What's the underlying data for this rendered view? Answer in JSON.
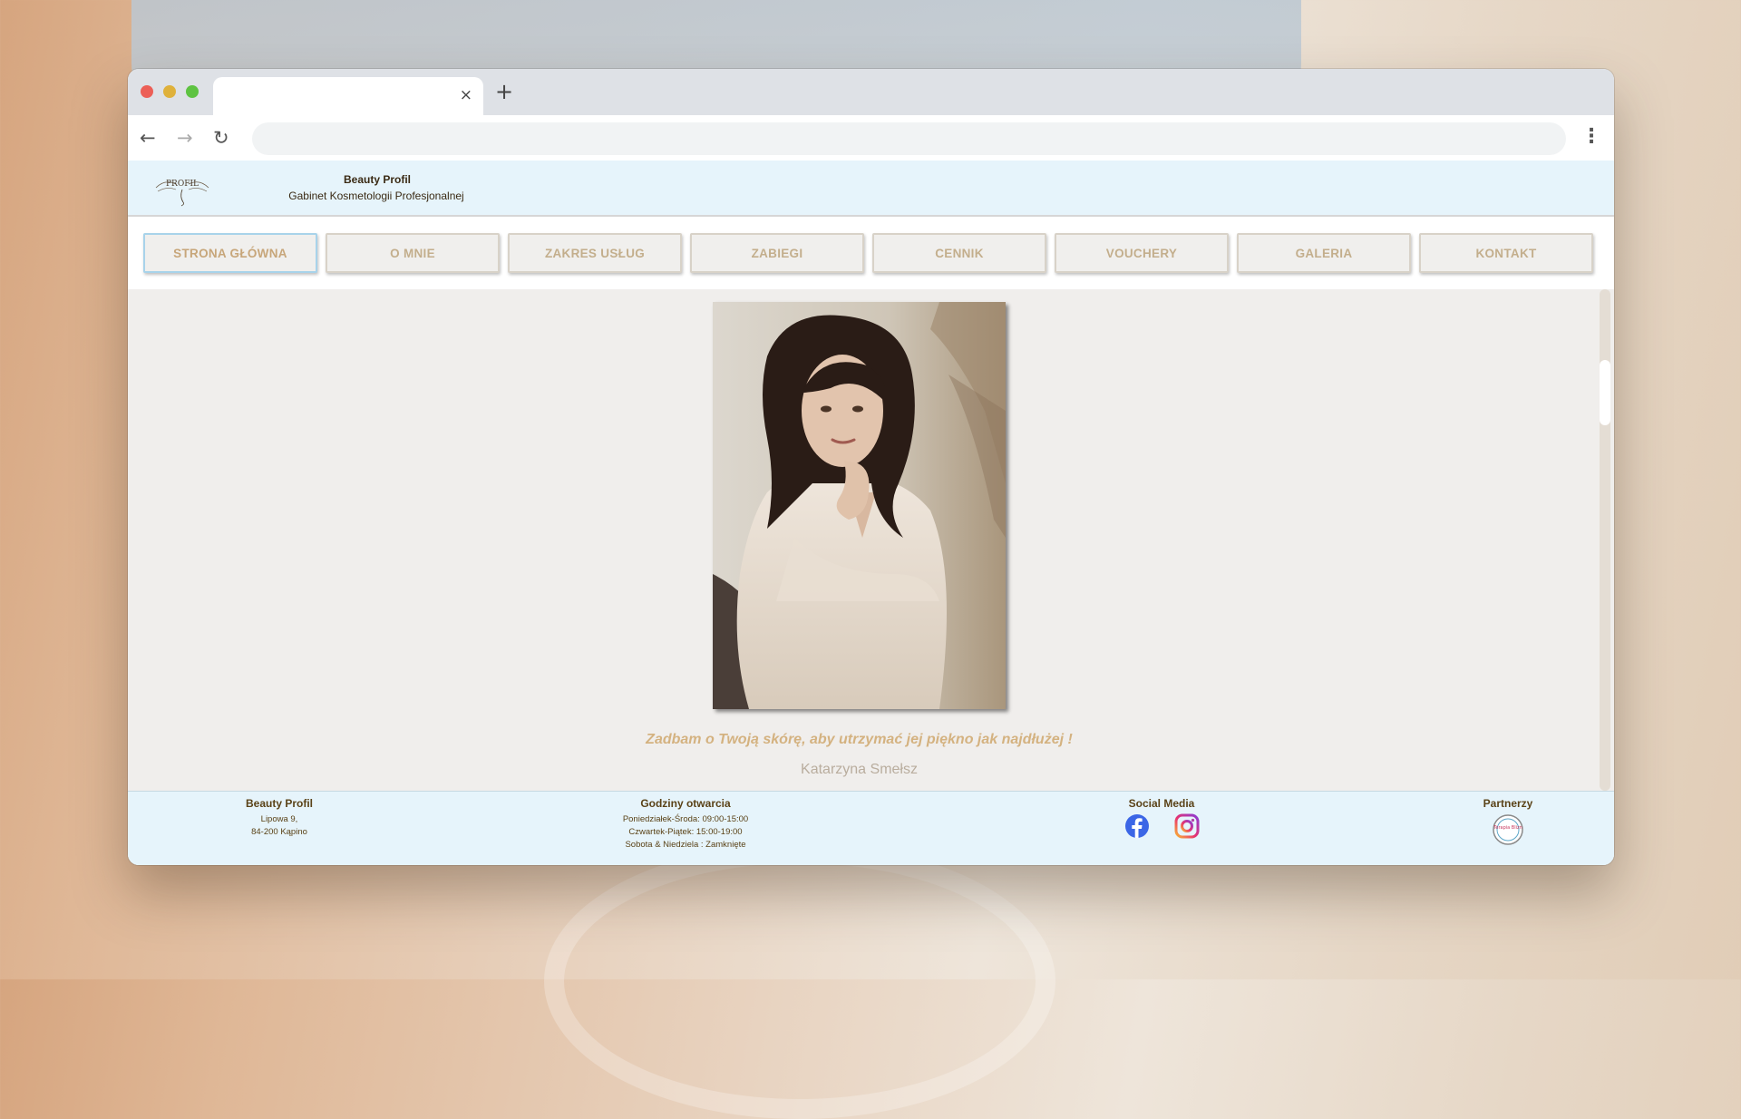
{
  "browser": {
    "tab_close": "×",
    "new_tab": "+",
    "back": "←",
    "forward": "→",
    "reload": "↻",
    "menu": "⋮"
  },
  "header": {
    "brand_title": "Beauty Profil",
    "brand_subtitle": "Gabinet Kosmetologii Profesjonalnej",
    "logo_text": "PROFIL"
  },
  "nav": {
    "items": [
      {
        "label": "STRONA GŁÓWNA",
        "active": true
      },
      {
        "label": "O MNIE"
      },
      {
        "label": "ZAKRES USŁUG"
      },
      {
        "label": "ZABIEGI"
      },
      {
        "label": "CENNIK"
      },
      {
        "label": "VOUCHERY"
      },
      {
        "label": "GALERIA"
      },
      {
        "label": "KONTAKT"
      }
    ]
  },
  "main": {
    "quote": "Zadbam o Twoją skórę, aby utrzymać jej piękno jak najdłużej !",
    "author": "Katarzyna Smełsz"
  },
  "footer": {
    "company": {
      "title": "Beauty Profil",
      "address_line1": "Lipowa 9,",
      "address_line2": "84-200 Kąpino"
    },
    "hours": {
      "title": "Godziny otwarcia",
      "line1": "Poniedziałek-Środa: 09:00-15:00",
      "line2": "Czwartek-Piątek: 15:00-19:00",
      "line3": "Sobota & Niedziela : Zamknięte"
    },
    "social": {
      "title": "Social Media",
      "icons": [
        "facebook-icon",
        "instagram-icon"
      ]
    },
    "partners": {
      "title": "Partnerzy",
      "logo_text": "Terapia Blizn"
    }
  },
  "colors": {
    "nav_text": "#c3ae8c",
    "header_bg": "#e6f4fb",
    "quote": "#d4b280",
    "footer_text": "#5a4217"
  }
}
